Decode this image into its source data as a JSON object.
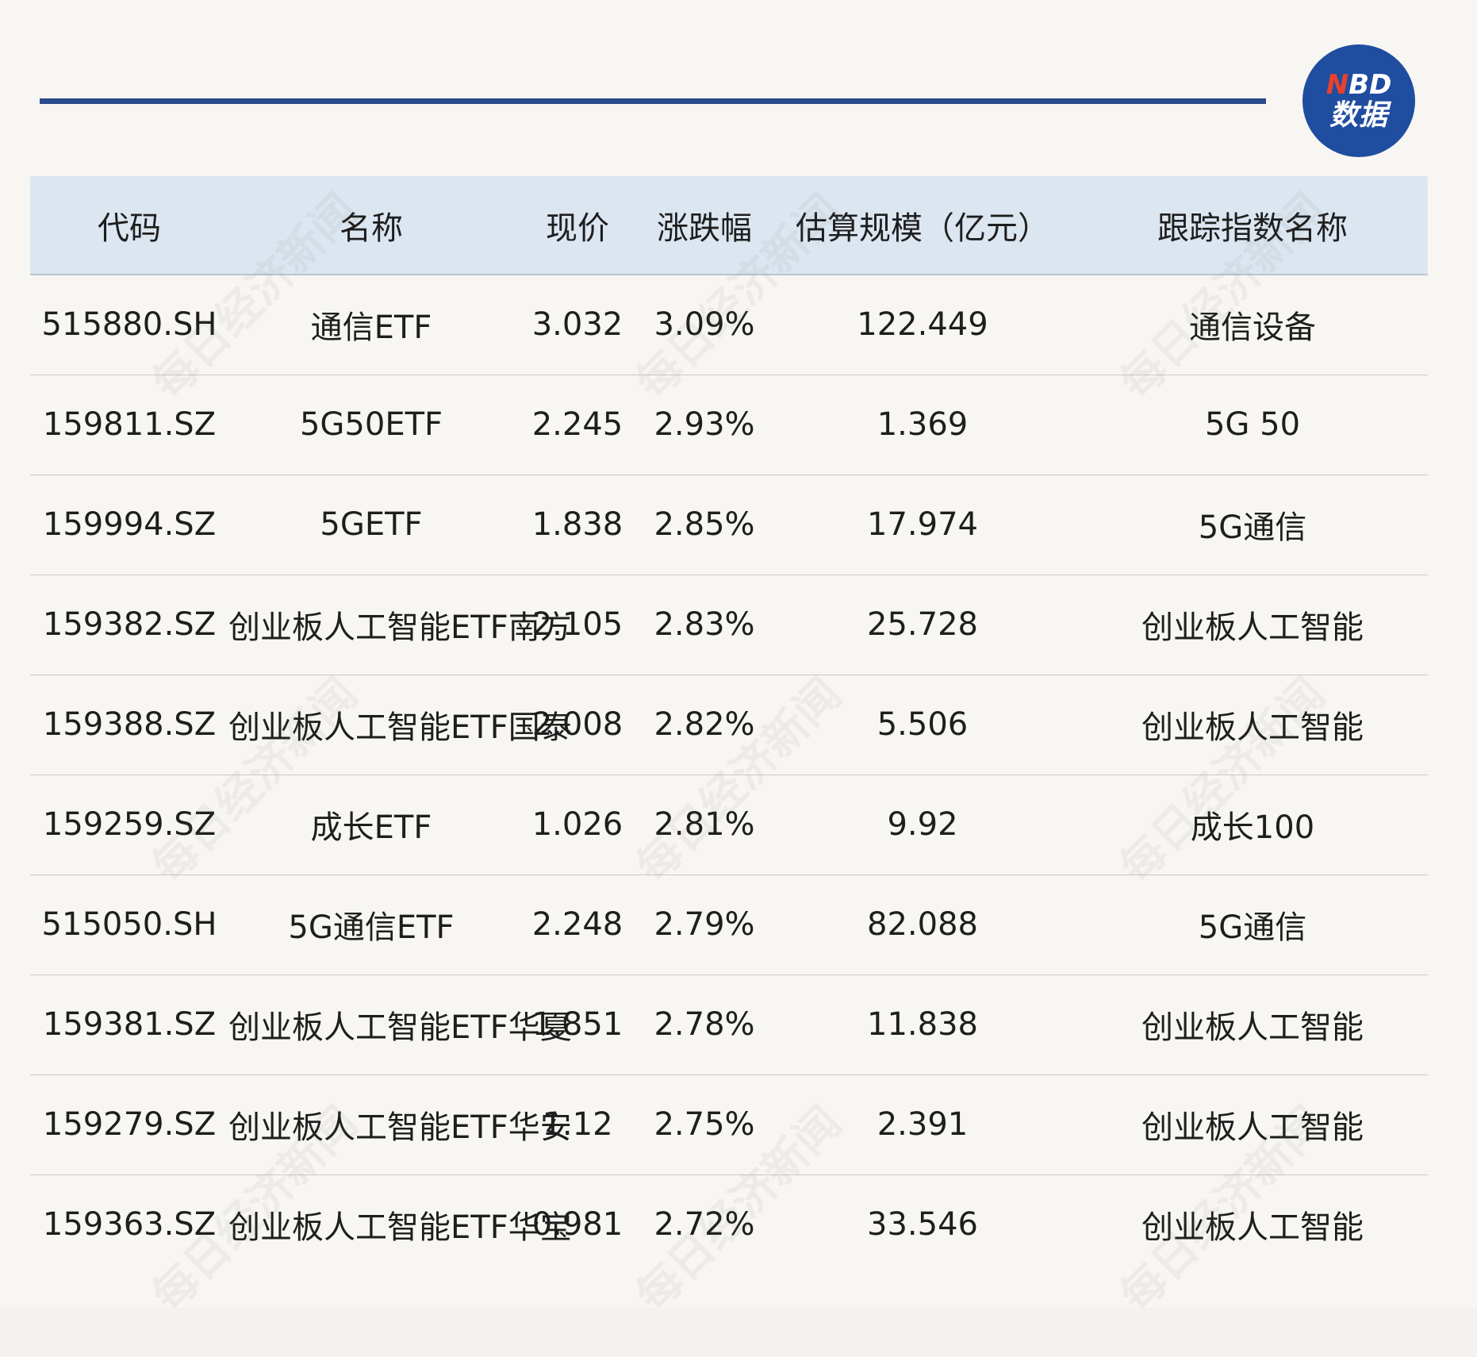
{
  "brand": {
    "logo_top_n": "N",
    "logo_top_rest": "BD",
    "logo_bottom": "数据",
    "accent_blue": "#1f4da0",
    "accent_red": "#e8412c"
  },
  "watermark_text": "每日经济新闻",
  "table": {
    "headers": {
      "code": "代码",
      "name": "名称",
      "price": "现价",
      "change": "涨跌幅",
      "scale": "估算规模（亿元）",
      "index": "跟踪指数名称"
    },
    "rows": [
      {
        "code": "515880.SH",
        "name": "通信ETF",
        "price": "3.032",
        "change": "3.09%",
        "scale": "122.449",
        "index": "通信设备"
      },
      {
        "code": "159811.SZ",
        "name": "5G50ETF",
        "price": "2.245",
        "change": "2.93%",
        "scale": "1.369",
        "index": "5G 50"
      },
      {
        "code": "159994.SZ",
        "name": "5GETF",
        "price": "1.838",
        "change": "2.85%",
        "scale": "17.974",
        "index": "5G通信"
      },
      {
        "code": "159382.SZ",
        "name": "创业板人工智能ETF南方",
        "price": "2.105",
        "change": "2.83%",
        "scale": "25.728",
        "index": "创业板人工智能"
      },
      {
        "code": "159388.SZ",
        "name": "创业板人工智能ETF国泰",
        "price": "2.008",
        "change": "2.82%",
        "scale": "5.506",
        "index": "创业板人工智能"
      },
      {
        "code": "159259.SZ",
        "name": "成长ETF",
        "price": "1.026",
        "change": "2.81%",
        "scale": "9.92",
        "index": "成长100"
      },
      {
        "code": "515050.SH",
        "name": "5G通信ETF",
        "price": "2.248",
        "change": "2.79%",
        "scale": "82.088",
        "index": "5G通信"
      },
      {
        "code": "159381.SZ",
        "name": "创业板人工智能ETF华夏",
        "price": "1.851",
        "change": "2.78%",
        "scale": "11.838",
        "index": "创业板人工智能"
      },
      {
        "code": "159279.SZ",
        "name": "创业板人工智能ETF华安",
        "price": "1.12",
        "change": "2.75%",
        "scale": "2.391",
        "index": "创业板人工智能"
      },
      {
        "code": "159363.SZ",
        "name": "创业板人工智能ETF华宝",
        "price": "0.981",
        "change": "2.72%",
        "scale": "33.546",
        "index": "创业板人工智能"
      }
    ]
  }
}
